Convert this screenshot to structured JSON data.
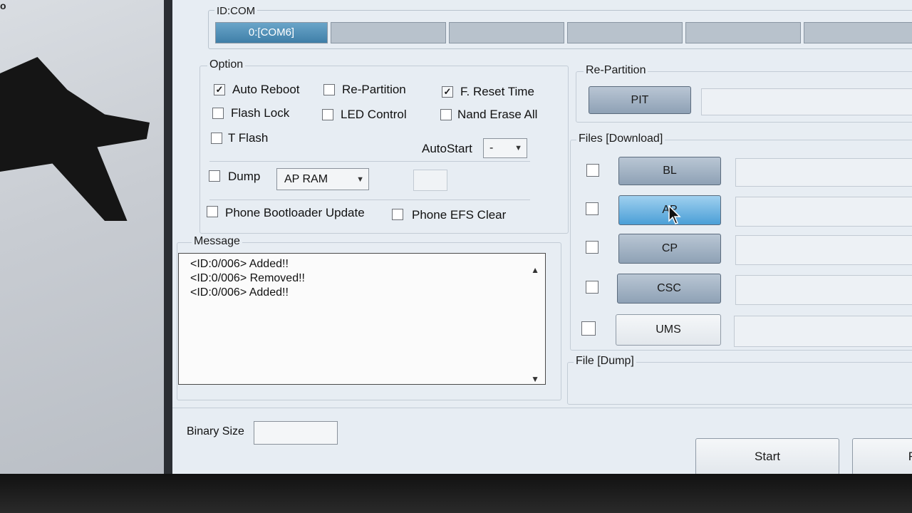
{
  "desktop": {
    "corner_text": "o"
  },
  "idcom": {
    "title": "ID:COM",
    "port_label": "0:[COM6]"
  },
  "option": {
    "title": "Option",
    "auto_reboot": {
      "label": "Auto Reboot",
      "checked": true
    },
    "re_partition": {
      "label": "Re-Partition",
      "checked": false
    },
    "f_reset_time": {
      "label": "F. Reset Time",
      "checked": true
    },
    "flash_lock": {
      "label": "Flash Lock",
      "checked": false
    },
    "led_control": {
      "label": "LED Control",
      "checked": false
    },
    "nand_erase_all": {
      "label": "Nand Erase All",
      "checked": false
    },
    "t_flash": {
      "label": "T Flash",
      "checked": false
    },
    "autostart_label": "AutoStart",
    "autostart_value": "-",
    "dump": {
      "label": "Dump",
      "checked": false
    },
    "dump_select_value": "AP RAM",
    "phone_bootloader_update": {
      "label": "Phone Bootloader Update",
      "checked": false
    },
    "phone_efs_clear": {
      "label": "Phone EFS Clear",
      "checked": false
    }
  },
  "message": {
    "title": "Message",
    "lines": [
      "<ID:0/006> Added!!",
      "<ID:0/006> Removed!!",
      "<ID:0/006> Added!!"
    ]
  },
  "re_partition_group": {
    "title": "Re-Partition",
    "pit_button": "PIT"
  },
  "files": {
    "title": "Files [Download]",
    "buttons": [
      "BL",
      "AP",
      "CP",
      "CSC",
      "UMS"
    ]
  },
  "file_dump": {
    "title": "File [Dump]"
  },
  "binary_size": {
    "label": "Binary Size"
  },
  "actions": {
    "start": "Start",
    "reset_partial": "R"
  },
  "colors": {
    "window_bg": "#e7edf3",
    "active_com": "#3f7fa8",
    "hot_button": "#4b9fd7"
  }
}
